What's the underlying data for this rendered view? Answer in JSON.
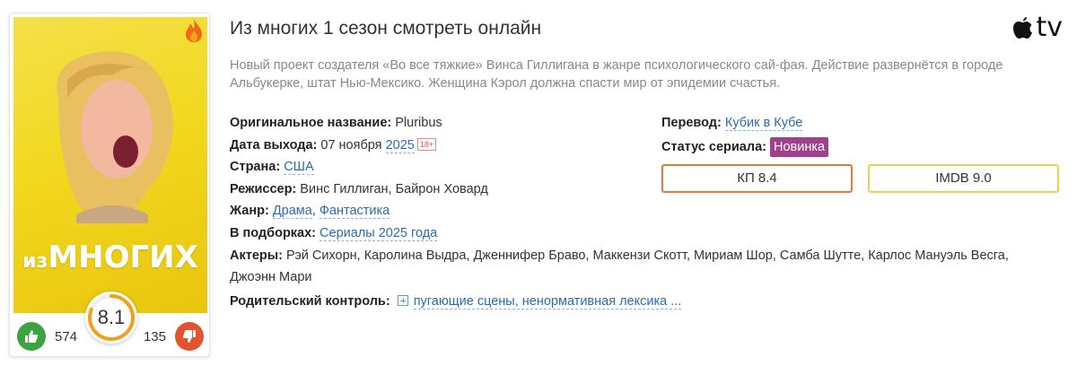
{
  "poster": {
    "title_small": "из",
    "title_big": "МНОГИХ",
    "rating": "8.1",
    "rating_fraction": 0.81,
    "likes": "574",
    "dislikes": "135"
  },
  "page": {
    "title": "Из многих 1 сезон смотреть онлайн",
    "brand": "tv",
    "description": "Новый проект создателя «Во все тяжкие» Винса Гиллигана в жанре психологического сай-фая. Действие развернётся в городе Альбукерке, штат Нью-Мексико. Женщина Кэрол должна спасти мир от эпидемии счастья."
  },
  "info": {
    "original_label": "Оригинальное название:",
    "original_value": "Pluribus",
    "release_label": "Дата выхода:",
    "release_date": "07 ноября",
    "release_year": "2025",
    "age": "18+",
    "country_label": "Страна:",
    "country": "США",
    "director_label": "Режиссер:",
    "director": "Винс Гиллиган, Байрон Ховард",
    "genre_label": "Жанр:",
    "genre_1": "Драма",
    "genre_sep": ", ",
    "genre_2": "Фантастика",
    "collections_label": "В подборках:",
    "collections": "Сериалы 2025 года",
    "actors_label": "Актеры:",
    "actors": "Рэй Сихорн, Каролина Выдра, Дженнифер Браво, Маккензи Скотт, Мириам Шор, Самба Шутте, Карлос Мануэль Весга, Джоэнн Мари",
    "parental_label": "Родительский контроль:",
    "parental": "пугающие сцены, ненормативная лексика ..."
  },
  "side": {
    "translation_label": "Перевод:",
    "translation": "Кубик в Кубе",
    "status_label": "Статус сериала:",
    "status": "Новинка",
    "kp": "КП 8.4",
    "imdb": "IMDB 9.0"
  },
  "colors": {
    "status_badge": "#a0408a",
    "like": "#3aa53e",
    "dislike": "#e2552c",
    "kp_border": "#e6793a",
    "imdb_border": "#f1d148",
    "rating_ring": "#f0a020"
  },
  "icons": [
    "fire-icon",
    "apple-icon",
    "thumbs-up-icon",
    "thumbs-down-icon",
    "plus-box-icon"
  ]
}
